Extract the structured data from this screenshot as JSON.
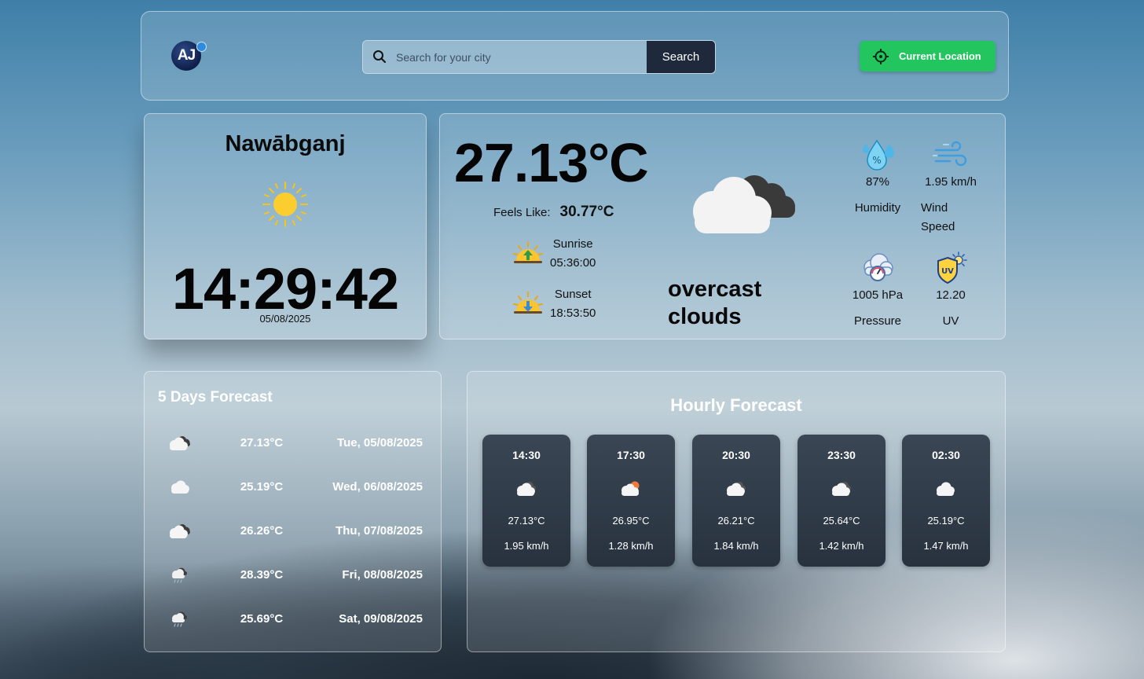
{
  "header": {
    "logo_text": "AJ",
    "search_placeholder": "Search for your city",
    "search_button": "Search",
    "location_button": "Current Location"
  },
  "clock": {
    "city": "Nawābganj",
    "time": "14:29:42",
    "date": "05/08/2025",
    "icon": "sun-icon"
  },
  "current": {
    "temperature": "27.13°C",
    "feels_like_label": "Feels Like:",
    "feels_like": "30.77°C",
    "sunrise_label": "Sunrise",
    "sunrise": "05:36:00",
    "sunset_label": "Sunset",
    "sunset": "18:53:50",
    "description": "overcast clouds",
    "icon": "overcast-clouds-icon",
    "metrics": {
      "humidity": {
        "value": "87%",
        "label": "Humidity",
        "icon": "humidity-icon"
      },
      "wind": {
        "value": "1.95 km/h",
        "label": "Wind Speed",
        "icon": "wind-icon"
      },
      "pressure": {
        "value": "1005 hPa",
        "label": "Pressure",
        "icon": "pressure-icon"
      },
      "uv": {
        "value": "12.20",
        "label": "UV",
        "icon": "uv-icon"
      }
    }
  },
  "forecast": {
    "title": "5 Days Forecast",
    "days": [
      {
        "temp": "27.13°C",
        "date": "Tue, 05/08/2025",
        "icon": "broken-clouds-icon"
      },
      {
        "temp": "25.19°C",
        "date": "Wed, 06/08/2025",
        "icon": "cloud-icon"
      },
      {
        "temp": "26.26°C",
        "date": "Thu, 07/08/2025",
        "icon": "broken-clouds-icon"
      },
      {
        "temp": "28.39°C",
        "date": "Fri, 08/08/2025",
        "icon": "rain-icon"
      },
      {
        "temp": "25.69°C",
        "date": "Sat, 09/08/2025",
        "icon": "rain-icon"
      }
    ]
  },
  "hourly": {
    "title": "Hourly Forecast",
    "hours": [
      {
        "time": "14:30",
        "temp": "27.13°C",
        "wind": "1.95 km/h",
        "icon": "cloud-icon"
      },
      {
        "time": "17:30",
        "temp": "26.95°C",
        "wind": "1.28 km/h",
        "icon": "partly-cloudy-icon"
      },
      {
        "time": "20:30",
        "temp": "26.21°C",
        "wind": "1.84 km/h",
        "icon": "cloud-icon"
      },
      {
        "time": "23:30",
        "temp": "25.64°C",
        "wind": "1.42 km/h",
        "icon": "cloud-icon"
      },
      {
        "time": "02:30",
        "temp": "25.19°C",
        "wind": "1.47 km/h",
        "icon": "cloud-icon"
      }
    ]
  },
  "colors": {
    "accent_green": "#22c55e",
    "search_button": "#1e293b",
    "hour_card": "#2f3a47"
  }
}
